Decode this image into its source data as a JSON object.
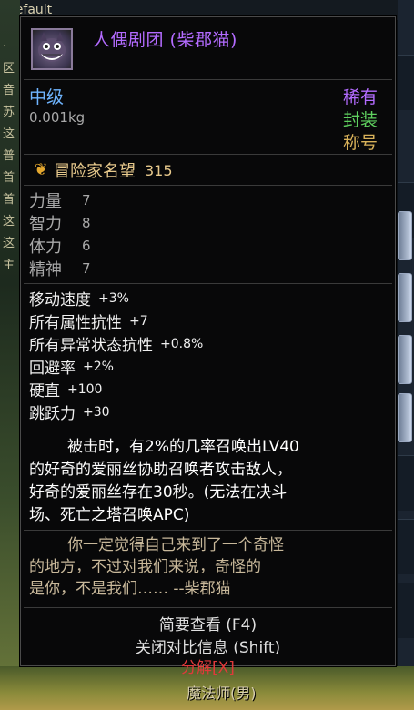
{
  "background": {
    "window_title": "Default",
    "left_marks": [
      "·",
      "区",
      "音",
      "苏",
      "这",
      "普",
      "首",
      "首",
      "这",
      "这",
      "主"
    ],
    "class_label": "魔法师(男)"
  },
  "tooltip": {
    "item_name": "人偶剧团 (柴郡猫)",
    "icon": "cheshire-cat-icon",
    "grade": "中级",
    "weight": "0.001kg",
    "rarity": "稀有",
    "sealed": "封装",
    "item_type": "称号",
    "fame": {
      "icon": "fame-icon",
      "label": "冒险家名望",
      "value": "315"
    },
    "stats": [
      {
        "name": "力量",
        "value": "7"
      },
      {
        "name": "智力",
        "value": "8"
      },
      {
        "name": "体力",
        "value": "6"
      },
      {
        "name": "精神",
        "value": "7"
      }
    ],
    "effects": [
      {
        "name": "移动速度",
        "value": "+3%"
      },
      {
        "name": "所有属性抗性",
        "value": "+7"
      },
      {
        "name": "所有异常状态抗性",
        "value": "+0.8%"
      },
      {
        "name": "回避率",
        "value": "+2%"
      },
      {
        "name": "硬直",
        "value": "+100"
      },
      {
        "name": "跳跃力",
        "value": "+30"
      }
    ],
    "skill_lines": [
      "被击时，有2%的几率召唤出LV40",
      "的好奇的爱丽丝协助召唤者攻击敌人，",
      "好奇的爱丽丝存在30秒。(无法在决斗",
      "场、死亡之塔召唤APC)"
    ],
    "flavor_lines": [
      "你一定觉得自己来到了一个奇怪",
      "的地方，不过对我们来说，奇怪的",
      "是你，不是我们…… --柴郡猫"
    ],
    "footer": {
      "brief_view": "简要查看 (F4)",
      "close_compare": "关闭对比信息 (Shift)",
      "disassemble": "分解[X]"
    }
  },
  "colors": {
    "epic_purple": "#b36bff",
    "grade_blue": "#6fb5ff",
    "sealed_green": "#5fd05f",
    "title_gold": "#d9b25a",
    "disassemble_red": "#e03a3a"
  }
}
